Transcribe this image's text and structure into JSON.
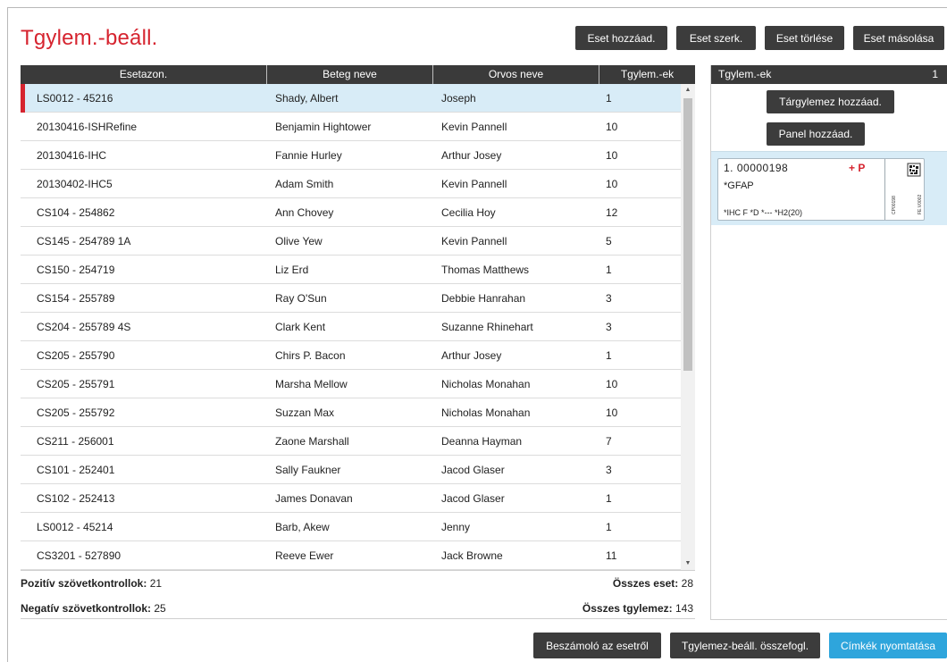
{
  "title": "Tgylem.-beáll.",
  "toolbar": {
    "add": "Eset hozzáad.",
    "edit": "Eset szerk.",
    "delete": "Eset törlése",
    "copy": "Eset másolása"
  },
  "table": {
    "columns": [
      "Esetazon.",
      "Beteg neve",
      "Orvos neve",
      "Tgylem.-ek"
    ],
    "rows": [
      [
        "LS0012 - 45216",
        "Shady, Albert",
        "Joseph",
        "1"
      ],
      [
        "20130416-ISHRefine",
        "Benjamin Hightower",
        "Kevin Pannell",
        "10"
      ],
      [
        "20130416-IHC",
        "Fannie Hurley",
        "Arthur Josey",
        "10"
      ],
      [
        "20130402-IHC5",
        "Adam Smith",
        "Kevin Pannell",
        "10"
      ],
      [
        "CS104 - 254862",
        "Ann Chovey",
        "Cecilia Hoy",
        "12"
      ],
      [
        "CS145 - 254789 1A",
        "Olive Yew",
        "Kevin Pannell",
        "5"
      ],
      [
        "CS150 - 254719",
        "Liz Erd",
        "Thomas Matthews",
        "1"
      ],
      [
        "CS154 - 255789",
        "Ray O'Sun",
        "Debbie Hanrahan",
        "3"
      ],
      [
        "CS204 - 255789 4S",
        "Clark Kent",
        "Suzanne Rhinehart",
        "3"
      ],
      [
        "CS205 - 255790",
        "Chirs P. Bacon",
        "Arthur Josey",
        "1"
      ],
      [
        "CS205 - 255791",
        "Marsha Mellow",
        "Nicholas Monahan",
        "10"
      ],
      [
        "CS205 - 255792",
        "Suzzan Max",
        "Nicholas Monahan",
        "10"
      ],
      [
        "CS211 - 256001",
        "Zaone Marshall",
        "Deanna Hayman",
        "7"
      ],
      [
        "CS101 - 252401",
        "Sally Faukner",
        "Jacod Glaser",
        "3"
      ],
      [
        "CS102 - 252413",
        "James Donavan",
        "Jacod Glaser",
        "1"
      ],
      [
        "LS0012 - 45214",
        "Barb, Akew",
        "Jenny",
        "1"
      ],
      [
        "CS3201 - 527890",
        "Reeve Ewer",
        "Jack Browne",
        "11"
      ]
    ]
  },
  "summary": {
    "positive_label": "Pozitív szövetkontrollok:",
    "positive_value": "21",
    "negative_label": "Negatív szövetkontrollok:",
    "negative_value": "25",
    "total_cases_label": "Összes eset:",
    "total_cases_value": "28",
    "total_slides_label": "Összes tgylemez:",
    "total_slides_value": "143"
  },
  "slides_panel": {
    "header": "Tgylem.-ek",
    "count": "1",
    "add_slide": "Tárgylemez hozzáad.",
    "add_panel": "Panel hozzáad.",
    "slide": {
      "number": "1. 00000198",
      "marks": "+ P",
      "reagent": "*GFAP",
      "protocols": "*IHC F  *D  *---  *H2(20)",
      "label_text_1": "CP00198",
      "label_text_2": "FE.V0002"
    }
  },
  "footer": {
    "report": "Beszámoló az esetről",
    "summary": "Tgylemez-beáll. összefogl.",
    "print": "Címkék nyomtatása"
  },
  "colors": {
    "accent_red": "#d6242f",
    "header_dark": "#3a3a3a",
    "selected_row": "#d8ecf7",
    "print_button": "#2ea5dc"
  }
}
